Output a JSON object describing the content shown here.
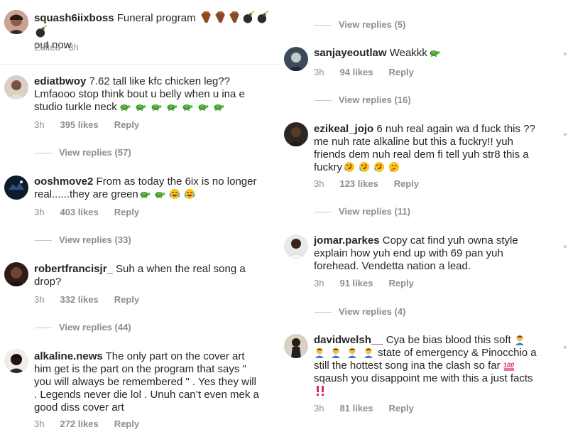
{
  "left": {
    "comments": [
      {
        "user": "squash6iixboss",
        "text": "Funeral program",
        "line2": "out now",
        "meta": "Edited · 3h"
      },
      {
        "user": "ediatbwoy",
        "line1": "7.62 tall like kfc chicken leg??",
        "line2": "Lmfaooo stop think bout u belly when u ina e",
        "line3": "studio turkle neck",
        "time": "3h",
        "likes": "395 likes",
        "reply": "Reply",
        "view_replies": "View replies (57)"
      },
      {
        "user": "ooshmove2",
        "line1": "From as today the 6ix is no longer",
        "line2": "real......they are green",
        "time": "3h",
        "likes": "403 likes",
        "reply": "Reply",
        "view_replies": "View replies (33)"
      },
      {
        "user": "robertfrancisjr_",
        "line1": "Suh a when the real song a",
        "line2": "drop?",
        "time": "3h",
        "likes": "332 likes",
        "reply": "Reply",
        "view_replies": "View replies (44)"
      },
      {
        "user": "alkaline.news",
        "line1": "The only part on the cover art",
        "line2": "him get is the part on the program that says \"",
        "line3": "you will always be remembered \" . Yes they will",
        "line4": ". Legends never die lol . Unuh can’t even mek a",
        "line5": "good diss cover art",
        "time": "3h",
        "likes": "272 likes",
        "reply": "Reply"
      }
    ]
  },
  "right": {
    "top_view_replies": "View replies (5)",
    "comments": [
      {
        "user": "sanjayeoutlaw",
        "line1": "Weakkk",
        "time": "3h",
        "likes": "94 likes",
        "reply": "Reply",
        "view_replies": "View replies (16)"
      },
      {
        "user": "ezikeal_jojo",
        "line1": "6 nuh real again wa d fuck this ??",
        "line2": "me nuh rate alkaline but this a fuckry!! yuh",
        "line3": "friends dem nuh real dem fi tell yuh str8 this a",
        "line4": "fuckry",
        "time": "3h",
        "likes": "123 likes",
        "reply": "Reply",
        "view_replies": "View replies (11)"
      },
      {
        "user": "jomar.parkes",
        "line1": "Copy cat find yuh owna style",
        "line2": "explain how yuh end up with 69 pan yuh",
        "line3": "forehead. Vendetta nation a lead.",
        "time": "3h",
        "likes": "91 likes",
        "reply": "Reply",
        "view_replies": "View replies (4)"
      },
      {
        "user": "davidwelsh__",
        "line1": "Cya be bias blood this soft",
        "line2": "state of emergency & Pinocchio a",
        "line3": "still the hottest song ina the clash so far",
        "line4": "sqaush you disappoint me with this a just facts",
        "time": "3h",
        "likes": "81 likes",
        "reply": "Reply"
      }
    ]
  },
  "icons": [
    "coffin-emoji",
    "bomb-emoji",
    "turtle-emoji",
    "joy-emoji",
    "rofl-emoji",
    "thinking-emoji",
    "100-emoji",
    "double-exclamation-emoji",
    "man-emoji"
  ]
}
